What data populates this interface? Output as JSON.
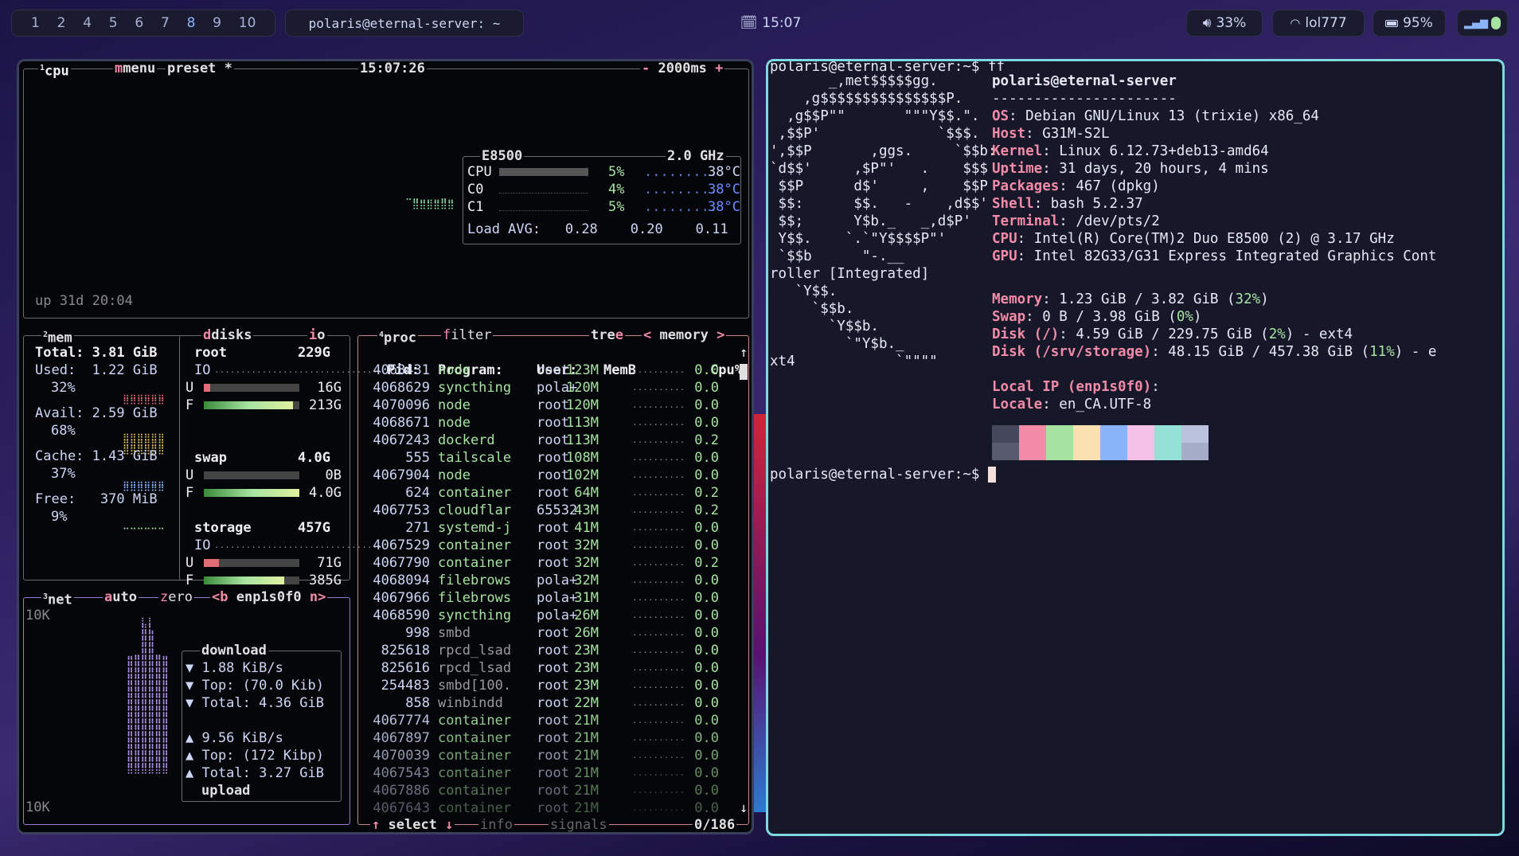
{
  "topbar": {
    "workspaces": [
      "1",
      "2",
      "4",
      "5",
      "6",
      "7",
      "8",
      "9",
      "10"
    ],
    "active_workspace": "8",
    "window_title": "polaris@eternal-server: ~",
    "clock": "15:07",
    "volume": "33%",
    "wifi": "lol777",
    "battery": "95%"
  },
  "btop": {
    "cpu_box": {
      "tab_num": "1",
      "tab": "cpu",
      "menu": "menu",
      "preset": "preset *",
      "time": "15:07:26",
      "minus": "-",
      "interval": "2000ms",
      "plus": "+",
      "uptime": "up 31d 20:04",
      "cpu_model": "E8500",
      "freq": "2.0 GHz",
      "rows": [
        {
          "name": "CPU",
          "pct": "5%",
          "temp": "38°C"
        },
        {
          "name": "C0",
          "pct": "4%",
          "temp": "38°C"
        },
        {
          "name": "C1",
          "pct": "5%",
          "temp": "38°C"
        }
      ],
      "load_label": "Load AVG:",
      "load": [
        "0.28",
        "0.20",
        "0.11"
      ]
    },
    "mem_box": {
      "tab_num": "2",
      "tab": "mem",
      "disks": "disks",
      "io": "io",
      "total": "Total: 3.81 GiB",
      "used_label": "Used:",
      "used": "1.22 GiB",
      "used_pct": "32%",
      "avail_label": "Avail:",
      "avail": "2.59 GiB",
      "avail_pct": "68%",
      "cache_label": "Cache:",
      "cache": "1.43 GiB",
      "cache_pct": "37%",
      "free_label": "Free:",
      "free": "370 MiB",
      "free_pct": "9%"
    },
    "disks": [
      {
        "name": "root",
        "size": "229G",
        "io": "IO",
        "used": "16G",
        "free": "213G",
        "used_frac": 0.07,
        "free_frac": 0.93
      },
      {
        "name": "swap",
        "size": "4.0G",
        "used": "0B",
        "free": "4.0G",
        "used_frac": 0.0,
        "free_frac": 1.0
      },
      {
        "name": "storage",
        "size": "457G",
        "io": "IO",
        "used": "71G",
        "free": "385G",
        "used_frac": 0.16,
        "free_frac": 0.84
      }
    ],
    "disk_u": "U",
    "disk_f": "F",
    "net_box": {
      "tab_num": "3",
      "tab": "net",
      "auto": "auto",
      "zero": "zero",
      "iface": "<b enp1s0f0 n>",
      "scale_top": "10K",
      "scale_bottom": "10K",
      "download": "download",
      "dl_rate": "▼ 1.88 KiB/s",
      "dl_top": "▼ Top: (70.0 Kib)",
      "dl_total": "▼ Total: 4.36 GiB",
      "ul_rate": "▲ 9.56 KiB/s",
      "ul_top": "▲ Top: (172 Kibp)",
      "ul_total": "▲ Total: 3.27 GiB",
      "upload": "upload"
    },
    "proc_box": {
      "tab_num": "4",
      "tab": "proc",
      "filter": "filter",
      "tree": "tree",
      "sort": "< memory >",
      "headers": [
        "Pid:",
        "Program:",
        "User:",
        "MemB",
        "Cpu%"
      ],
      "rows": [
        [
          "4068431",
          "node",
          "root",
          "123M",
          "0.0"
        ],
        [
          "4068629",
          "syncthing",
          "pola+",
          "120M",
          "0.0"
        ],
        [
          "4070096",
          "node",
          "root",
          "120M",
          "0.0"
        ],
        [
          "4068671",
          "node",
          "root",
          "113M",
          "0.0"
        ],
        [
          "4067243",
          "dockerd",
          "root",
          "113M",
          "0.2"
        ],
        [
          "555",
          "tailscale",
          "root",
          "108M",
          "0.0"
        ],
        [
          "4067904",
          "node",
          "root",
          "102M",
          "0.0"
        ],
        [
          "624",
          "container",
          "root",
          "64M",
          "0.2"
        ],
        [
          "4067753",
          "cloudflar",
          "65532",
          "43M",
          "0.2"
        ],
        [
          "271",
          "systemd-j",
          "root",
          "41M",
          "0.0"
        ],
        [
          "4067529",
          "container",
          "root",
          "32M",
          "0.0"
        ],
        [
          "4067790",
          "container",
          "root",
          "32M",
          "0.2"
        ],
        [
          "4068094",
          "filebrows",
          "pola+",
          "32M",
          "0.0"
        ],
        [
          "4067966",
          "filebrows",
          "pola+",
          "31M",
          "0.0"
        ],
        [
          "4068590",
          "syncthing",
          "pola+",
          "26M",
          "0.0"
        ],
        [
          "998",
          "smbd",
          "root",
          "26M",
          "0.0"
        ],
        [
          "825618",
          "rpcd_lsad",
          "root",
          "23M",
          "0.0"
        ],
        [
          "825616",
          "rpcd_lsad",
          "root",
          "23M",
          "0.0"
        ],
        [
          "254483",
          "smbd[100.",
          "root",
          "23M",
          "0.0"
        ],
        [
          "858",
          "winbindd",
          "root",
          "22M",
          "0.0"
        ],
        [
          "4067774",
          "container",
          "root",
          "21M",
          "0.0"
        ],
        [
          "4067897",
          "container",
          "root",
          "21M",
          "0.0"
        ],
        [
          "4070039",
          "container",
          "root",
          "21M",
          "0.0"
        ],
        [
          "4067543",
          "container",
          "root",
          "21M",
          "0.0"
        ],
        [
          "4067886",
          "container",
          "root",
          "21M",
          "0.0"
        ],
        [
          "4067643",
          "container",
          "root",
          "21M",
          "0.0"
        ]
      ],
      "footer_select": "select",
      "footer_info": "info",
      "footer_signals": "signals",
      "count": "0/186"
    }
  },
  "terminal": {
    "prompt1": "polaris@eternal-server:~$ ff",
    "logo": [
      "       _,met$$$$$gg.",
      "    ,g$$$$$$$$$$$$$$$P.",
      "  ,g$$P\"\"       \"\"\"Y$$.\".",
      " ,$$P'              `$$$.",
      "',$$P       ,ggs.     `$$b:",
      "`d$$'     ,$P\"'   .    $$$",
      " $$P      d$'     ,    $$P",
      " $$:      $$.   -    ,d$$'",
      " $$;      Y$b._   _,d$P'",
      " Y$$.    `.`\"Y$$$$P\"'",
      " `$$b      \"-.__",
      "roller [Integrated]",
      "   `Y$$.",
      "     `$$b.",
      "       `Y$$b.",
      "         `\"Y$b._",
      "xt4            `\"\"\"\""
    ],
    "user_host": "polaris@eternal-server",
    "separator": "----------------------",
    "info": [
      {
        "k": "OS",
        "v": ": Debian GNU/Linux 13 (trixie) x86_64"
      },
      {
        "k": "Host",
        "v": ": G31M-S2L"
      },
      {
        "k": "Kernel",
        "v": ": Linux 6.12.73+deb13-amd64"
      },
      {
        "k": "Uptime",
        "v": ": 31 days, 20 hours, 4 mins"
      },
      {
        "k": "Packages",
        "v": ": 467 (dpkg)"
      },
      {
        "k": "Shell",
        "v": ": bash 5.2.37"
      },
      {
        "k": "Terminal",
        "v": ": /dev/pts/2"
      },
      {
        "k": "CPU",
        "v": ": Intel(R) Core(TM)2 Duo E8500 (2) @ 3.17 GHz"
      },
      {
        "k": "GPU",
        "v": ": Intel 82G33/G31 Express Integrated Graphics Cont"
      }
    ],
    "mem": {
      "k": "Memory",
      "v1": ": 1.23 GiB / 3.82 GiB (",
      "p": "32%",
      "v2": ")"
    },
    "swap": {
      "k": "Swap",
      "v1": ": 0 B / 3.98 GiB (",
      "p": "0%",
      "v2": ")"
    },
    "disk1": {
      "k": "Disk (/)",
      "v1": ": 4.59 GiB / 229.75 GiB (",
      "p": "2%",
      "v2": ") - ext4"
    },
    "disk2": {
      "k": "Disk (/srv/storage)",
      "v1": ": 48.15 GiB / 457.38 GiB (",
      "p": "11%",
      "v2": ") - e"
    },
    "ip": {
      "k": "Local IP (enp1s0f0)",
      "v": ":"
    },
    "locale": {
      "k": "Locale",
      "v": ": en_CA.UTF-8"
    },
    "swatches_top": [
      "#45475a",
      "#f38ba8",
      "#a6e3a1",
      "#f9e2af",
      "#89b4fa",
      "#f5c2e7",
      "#94e2d5",
      "#bac2de"
    ],
    "swatches_bottom": [
      "#585b70",
      "#f38ba8",
      "#a6e3a1",
      "#f9e2af",
      "#89b4fa",
      "#f5c2e7",
      "#94e2d5",
      "#a6adc8"
    ],
    "prompt2": "polaris@eternal-server:~$ "
  }
}
